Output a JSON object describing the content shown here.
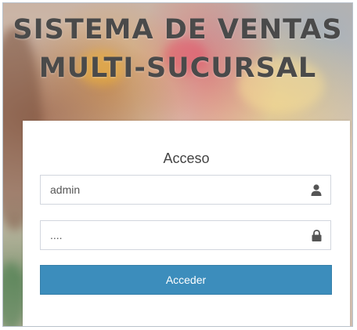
{
  "header": {
    "title_line1": "SISTEMA DE VENTAS",
    "title_line2": "MULTI-SUCURSAL"
  },
  "login": {
    "heading": "Acceso",
    "username_value": "admin",
    "username_icon": "user-icon",
    "password_value": "....",
    "password_icon": "lock-icon",
    "submit_label": "Acceder"
  },
  "colors": {
    "button": "#3c8dbc",
    "title_text": "#4a4a4a"
  }
}
